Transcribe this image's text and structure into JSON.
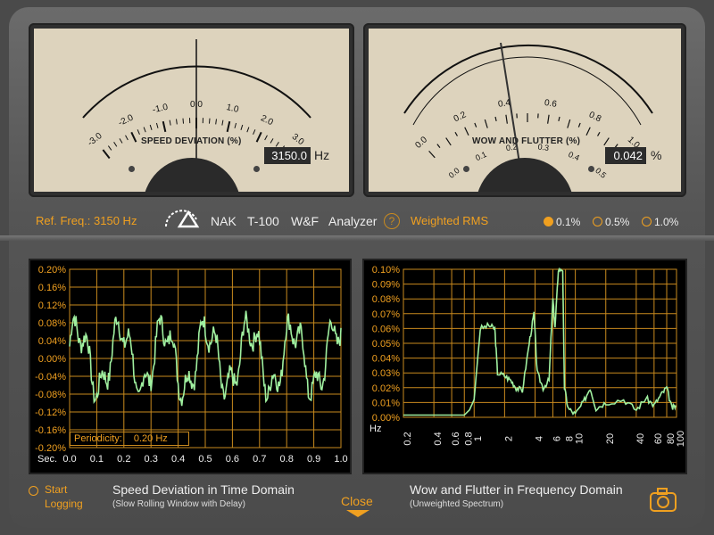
{
  "meter_left": {
    "title": "SPEED DEVIATION (%)",
    "ticks": [
      "-3.0",
      "-2.0",
      "-1.0",
      "0.0",
      "1.0",
      "2.0",
      "3.0"
    ],
    "readout": "3150.0",
    "unit": "Hz",
    "needle_value": 0.0
  },
  "meter_right": {
    "title": "WOW AND FLUTTER (%)",
    "outer_ticks": [
      "0.0",
      "0.2",
      "0.4",
      "0.6",
      "0.8",
      "1.0"
    ],
    "inner_ticks": [
      "0.0",
      "0.1",
      "0.2",
      "0.3",
      "0.4",
      "0.5"
    ],
    "readout": "0.042",
    "unit": "%",
    "needle_value": 0.042
  },
  "info": {
    "ref_freq": "Ref. Freq.: 3150 Hz",
    "brand": "NAK",
    "model": "T-100",
    "wf": "W&F",
    "analyzer": "Analyzer",
    "help": "?",
    "weighting": "Weighted RMS",
    "ranges": [
      {
        "label": "0.1%",
        "selected": true
      },
      {
        "label": "0.5%",
        "selected": false
      },
      {
        "label": "1.0%",
        "selected": false
      }
    ]
  },
  "chart_data": [
    {
      "type": "line",
      "title": "Speed Deviation in Time Domain",
      "subtitle": "(Slow Rolling Window with Delay)",
      "xlabel": "Sec.",
      "x_ticks": [
        "0.0",
        "0.1",
        "0.2",
        "0.3",
        "0.4",
        "0.5",
        "0.6",
        "0.7",
        "0.8",
        "0.9",
        "1.0"
      ],
      "y_ticks": [
        "0.20%",
        "0.16%",
        "0.12%",
        "0.08%",
        "0.04%",
        "0.00%",
        "-0.04%",
        "-0.08%",
        "-0.12%",
        "-0.16%",
        "-0.20%"
      ],
      "xlim": [
        0,
        1.0
      ],
      "ylim": [
        -0.2,
        0.2
      ],
      "annotation_label": "Periodicity:",
      "annotation_value": "0.20 Hz",
      "line_color": "#a0f0a0",
      "grid_color": "#c98a1e"
    },
    {
      "type": "line",
      "title": "Wow and Flutter in Frequency Domain",
      "subtitle": "(Unweighted Spectrum)",
      "xlabel": "Hz",
      "x_ticks": [
        "0.2",
        "0.4",
        "0.6",
        "0.8",
        "1",
        "2",
        "4",
        "6",
        "8",
        "10",
        "20",
        "40",
        "60",
        "80",
        "100"
      ],
      "y_ticks": [
        "0.10%",
        "0.09%",
        "0.08%",
        "0.07%",
        "0.06%",
        "0.05%",
        "0.04%",
        "0.03%",
        "0.02%",
        "0.01%",
        "0.00%"
      ],
      "xlim": [
        0.2,
        100
      ],
      "ylim": [
        0,
        0.1
      ],
      "x_scale": "log",
      "line_color": "#a0f0a0",
      "grid_color": "#c98a1e"
    }
  ],
  "footer": {
    "start_logging": "Start Logging",
    "close": "Close"
  },
  "colors": {
    "accent": "#f0a020",
    "trace": "#a0f0a0",
    "meter_face": "#ddd3bd"
  }
}
